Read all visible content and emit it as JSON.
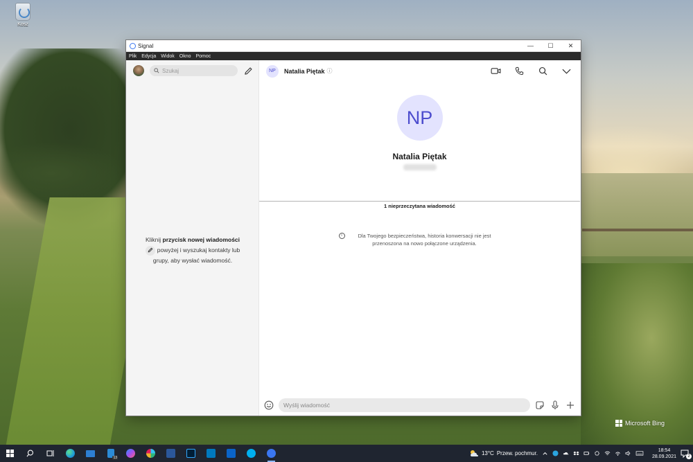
{
  "desktop": {
    "recycle_bin_label": "Kosz",
    "bing_label": "Microsoft Bing"
  },
  "window": {
    "title": "Signal",
    "controls": {
      "minimize": "—",
      "maximize": "☐",
      "close": "✕"
    },
    "menu": [
      "Plik",
      "Edycja",
      "Widok",
      "Okno",
      "Pomoc"
    ]
  },
  "sidebar": {
    "search_placeholder": "Szukaj",
    "empty_prefix": "Kliknij ",
    "empty_bold": "przycisk nowej wiadomości",
    "empty_line2": "powyżej i wyszukaj kontakty lub",
    "empty_line3": "grupy, aby wysłać wiadomość."
  },
  "conversation": {
    "contact_initials": "NP",
    "contact_name": "Natalia Piętak",
    "contact_info_icon": "ⓘ",
    "unread_label": "1 nieprzeczytana wiadomość",
    "notice_line1": "Dla Twojego bezpieczeństwa, historia konwersacji nie jest",
    "notice_line2": "przenoszona na nowo połączone urządzenia.",
    "composer_placeholder": "Wyślij wiadomość"
  },
  "taskbar": {
    "mail_badge": "13",
    "weather_temp": "13°C",
    "weather_text": "Przew. pochmur.",
    "time": "18:54",
    "date": "28.09.2021",
    "notification_count": "2",
    "app_colors": {
      "edge": "#1f9fd8",
      "mail": "#2d7fd3",
      "files": "#2b8bd6",
      "messenger": "#a050f0",
      "slack": "#e8e8e8",
      "word": "#2b579a",
      "photoshop": "#31a8ff",
      "trello": "#0079bf",
      "outlook": "#0a64c8",
      "skype": "#00aff0",
      "signal": "#3a76f0"
    }
  },
  "colors": {
    "accent": "#3a76f0",
    "avatar_bg": "#e3e3fe",
    "avatar_fg": "#4d4dce"
  }
}
